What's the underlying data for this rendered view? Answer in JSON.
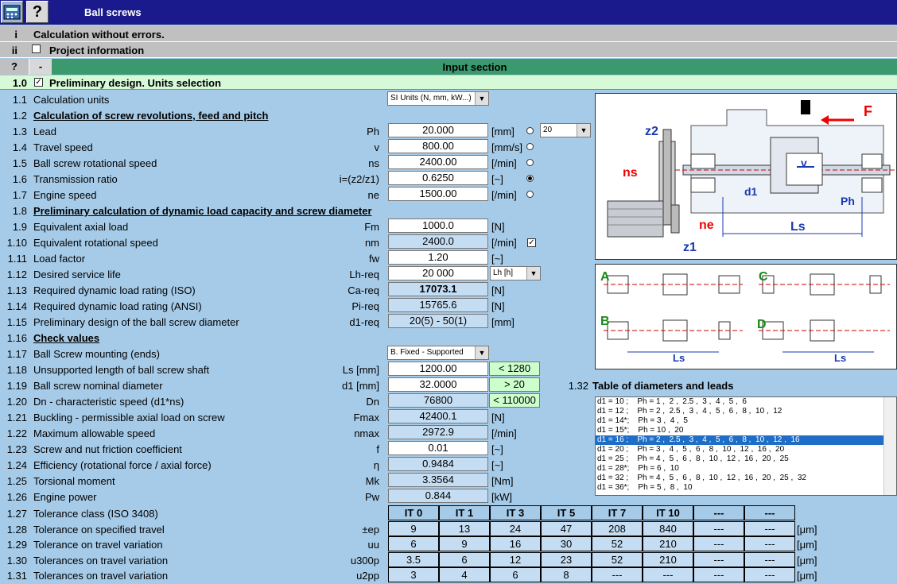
{
  "app": {
    "title": "Ball screws",
    "help_label": "?"
  },
  "status": {
    "num": "i",
    "text": "Calculation without errors."
  },
  "project": {
    "num": "ii",
    "text": "Project information"
  },
  "input_bar": {
    "num": "?",
    "minus": "-",
    "title": "Input section"
  },
  "prelim": {
    "num": "1.0",
    "text": "Preliminary design. Units selection"
  },
  "rows": [
    {
      "num": "1.1",
      "label": "Calculation units",
      "select": "SI Units (N, mm, kW...)"
    },
    {
      "num": "1.2",
      "label": "Calculation of screw revolutions, feed and pitch"
    },
    {
      "num": "1.3",
      "label": "Lead",
      "sym": "Ph",
      "val": "20.000",
      "unit": "[mm]",
      "select": "20"
    },
    {
      "num": "1.4",
      "label": "Travel speed",
      "sym": "v",
      "val": "800.00",
      "unit": "[mm/s]"
    },
    {
      "num": "1.5",
      "label": "Ball screw rotational speed",
      "sym": "ns",
      "val": "2400.00",
      "unit": "[/min]"
    },
    {
      "num": "1.6",
      "label": "Transmission ratio",
      "sym": "i=(z2/z1)",
      "val": "0.6250",
      "unit": "[~]"
    },
    {
      "num": "1.7",
      "label": "Engine speed",
      "sym": "ne",
      "val": "1500.00",
      "unit": "[/min]"
    },
    {
      "num": "1.8",
      "label": "Preliminary calculation of dynamic load capacity and screw diameter"
    },
    {
      "num": "1.9",
      "label": "Equivalent axial load",
      "sym": "Fm",
      "val": "1000.0",
      "unit": "[N]"
    },
    {
      "num": "1.10",
      "label": "Equivalent rotational speed",
      "sym": "nm",
      "val": "2400.0",
      "unit": "[/min]"
    },
    {
      "num": "1.11",
      "label": "Load factor",
      "sym": "fw",
      "val": "1.20",
      "unit": "[~]"
    },
    {
      "num": "1.12",
      "label": "Desired service life",
      "sym": "Lh-req",
      "val": "20 000",
      "select": "Lh [h]"
    },
    {
      "num": "1.13",
      "label": "Required dynamic load rating (ISO)",
      "sym": "Ca-req",
      "val": "17073.1",
      "unit": "[N]"
    },
    {
      "num": "1.14",
      "label": "Required dynamic load rating (ANSI)",
      "sym": "Pi-req",
      "val": "15765.6",
      "unit": "[N]"
    },
    {
      "num": "1.15",
      "label": "Preliminary design of the ball screw diameter",
      "sym": "d1-req",
      "val": "20(5) - 50(1)",
      "unit": "[mm]"
    },
    {
      "num": "1.16",
      "label": "Check values"
    },
    {
      "num": "1.17",
      "label": "Ball Screw mounting (ends)",
      "select": "B. Fixed - Supported"
    },
    {
      "num": "1.18",
      "label": "Unsupported length of ball screw shaft",
      "sym": "Ls [mm]",
      "val": "1200.00",
      "check": "< 1280"
    },
    {
      "num": "1.19",
      "label": "Ball screw nominal diameter",
      "sym": "d1 [mm]",
      "val": "32.0000",
      "check": "> 20"
    },
    {
      "num": "1.20",
      "label": "Dn - characteristic speed (d1*ns)",
      "sym": "Dn",
      "val": "76800",
      "check": "< 110000"
    },
    {
      "num": "1.21",
      "label": "Buckling - permissible axial load on screw",
      "sym": "Fmax",
      "val": "42400.1",
      "unit": "[N]"
    },
    {
      "num": "1.22",
      "label": "Maximum allowable speed",
      "sym": "nmax",
      "val": "2972.9",
      "unit": "[/min]"
    },
    {
      "num": "1.23",
      "label": "Screw and nut friction coefficient",
      "sym": "f",
      "val": "0.01",
      "unit": "[~]"
    },
    {
      "num": "1.24",
      "label": "Efficiency (rotational force / axial force)",
      "sym": "η",
      "val": "0.9484",
      "unit": "[~]"
    },
    {
      "num": "1.25",
      "label": "Torsional moment",
      "sym": "Mk",
      "val": "3.3564",
      "unit": "[Nm]"
    },
    {
      "num": "1.26",
      "label": "Engine power",
      "sym": "Pw",
      "val": "0.844",
      "unit": "[kW]"
    }
  ],
  "tolerance": {
    "rows": [
      {
        "num": "1.27",
        "label": "Tolerance class (ISO 3408)",
        "sym": "",
        "cells": [
          "IT 0",
          "IT 1",
          "IT 3",
          "IT 5",
          "IT 7",
          "IT 10",
          "---",
          "---"
        ],
        "unit": ""
      },
      {
        "num": "1.28",
        "label": "Tolerance on specified travel",
        "sym": "±ep",
        "cells": [
          "9",
          "13",
          "24",
          "47",
          "208",
          "840",
          "---",
          "---"
        ],
        "unit": "[μm]"
      },
      {
        "num": "1.29",
        "label": "Tolerance on travel variation",
        "sym": "uu",
        "cells": [
          "6",
          "9",
          "16",
          "30",
          "52",
          "210",
          "---",
          "---"
        ],
        "unit": "[μm]"
      },
      {
        "num": "1.30",
        "label": "Tolerances on travel variation",
        "sym": "u300p",
        "cells": [
          "3.5",
          "6",
          "12",
          "23",
          "52",
          "210",
          "---",
          "---"
        ],
        "unit": "[μm]"
      },
      {
        "num": "1.31",
        "label": "Tolerances on travel variation",
        "sym": "u2pp",
        "cells": [
          "3",
          "4",
          "6",
          "8",
          "---",
          "---",
          "---",
          "---"
        ],
        "unit": "[μm]"
      }
    ]
  },
  "diagram1": {
    "F": "F",
    "z2": "z2",
    "ns": "ns",
    "v": "v",
    "d1": "d1",
    "Ph": "Ph",
    "ne": "ne",
    "Ls": "Ls",
    "z1": "z1"
  },
  "diagram2": {
    "A": "A",
    "B": "B",
    "C": "C",
    "D": "D",
    "Ls": "Ls"
  },
  "table": {
    "num": "1.32",
    "title": "Table of diameters and leads",
    "items": [
      "d1 = 10 ;    Ph = 1 ,  2 ,  2.5 ,  3 ,  4 ,  5 ,  6",
      "d1 = 12 ;    Ph = 2 ,  2.5 ,  3 ,  4 ,  5 ,  6 ,  8 ,  10 ,  12",
      "d1 = 14*;    Ph = 3 ,  4 ,  5",
      "d1 = 15*;    Ph = 10 ,  20",
      "d1 = 16 ;    Ph = 2 ,  2.5 ,  3 ,  4 ,  5 ,  6 ,  8 ,  10 ,  12 ,  16",
      "d1 = 20 ;    Ph = 3 ,  4 ,  5 ,  6 ,  8 ,  10 ,  12 ,  16 ,  20",
      "d1 = 25 ;    Ph = 4 ,  5 ,  6 ,  8 ,  10 ,  12 ,  16 ,  20 ,  25",
      "d1 = 28*;    Ph = 6 ,  10",
      "d1 = 32 ;    Ph = 4 ,  5 ,  6 ,  8 ,  10 ,  12 ,  16 ,  20 ,  25 ,  32",
      "d1 = 36*;    Ph = 5 ,  8 ,  10"
    ],
    "selected_index": 4
  }
}
